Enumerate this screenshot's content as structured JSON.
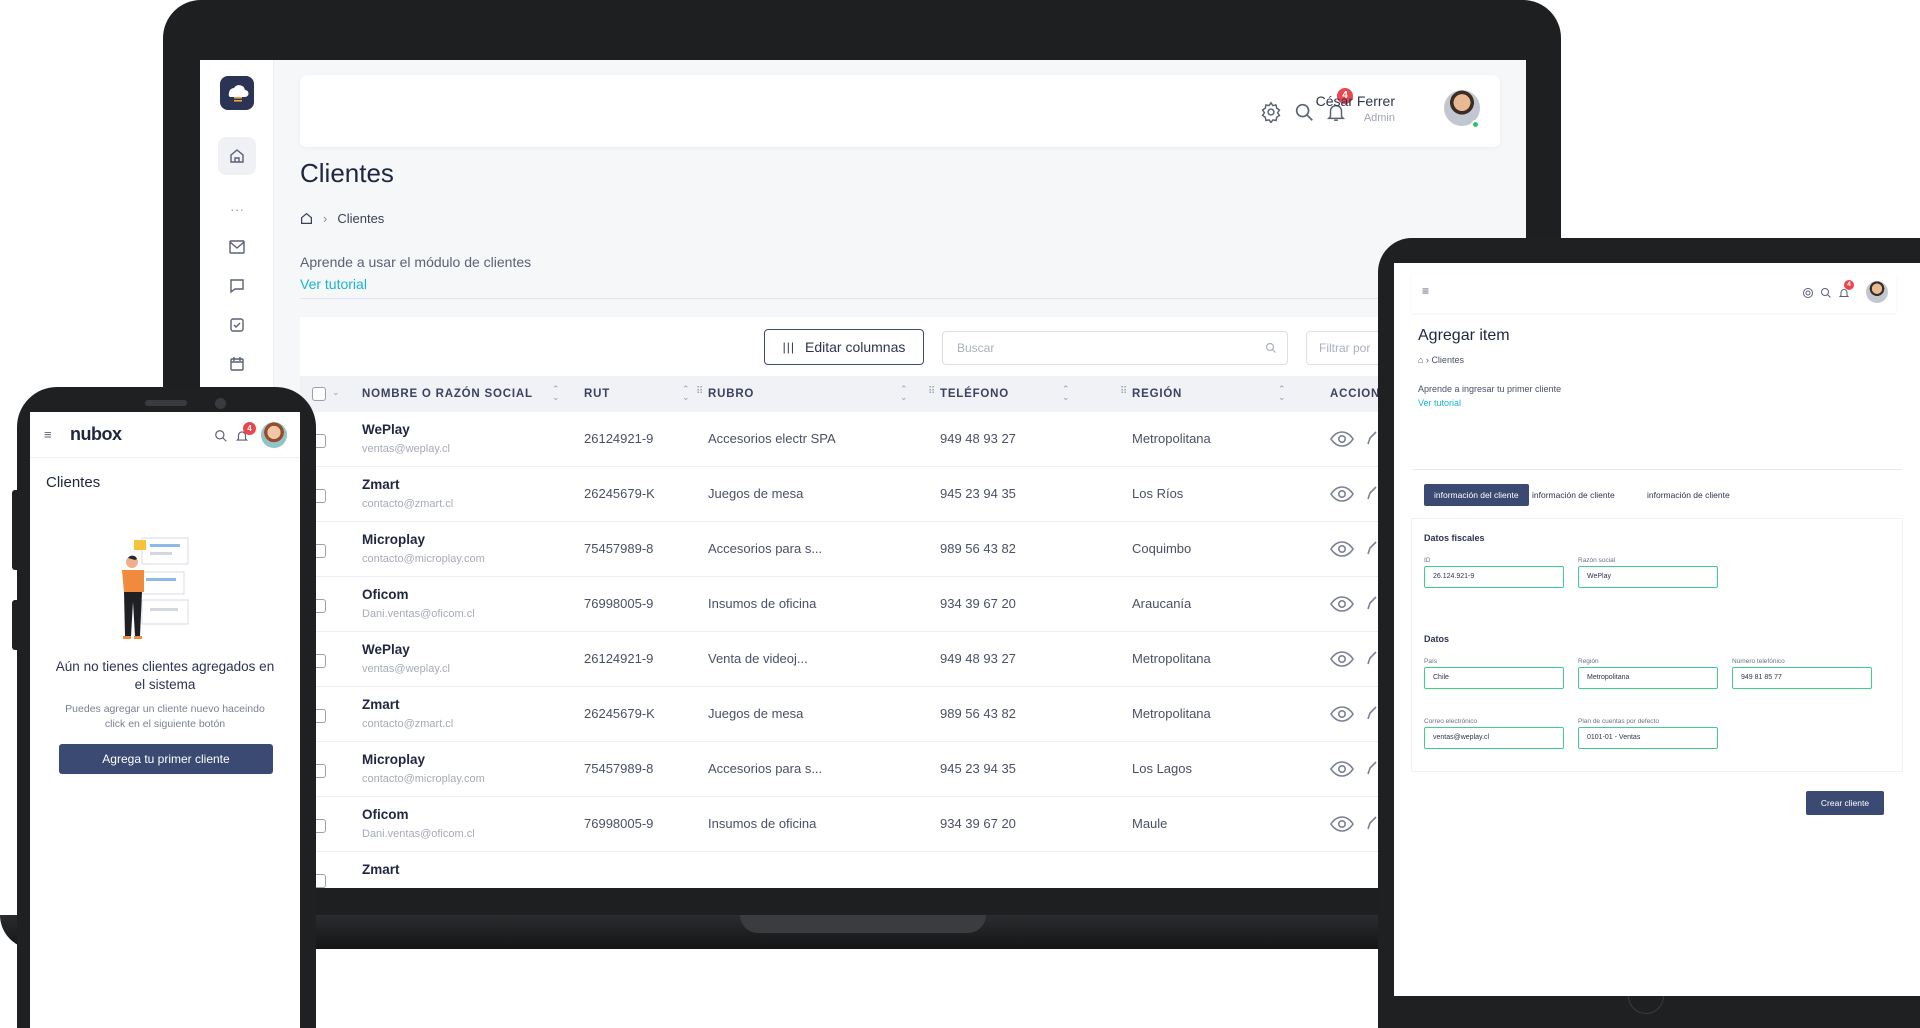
{
  "laptop": {
    "user": {
      "name": "César Ferrer",
      "role": "Admin",
      "notifications": "4"
    },
    "page_title": "Clientes",
    "breadcrumb": {
      "current": "Clientes"
    },
    "learn_text": "Aprende a usar el módulo de clientes",
    "tutorial_link": "Ver tutorial",
    "toolbar": {
      "edit_columns": "Editar columnas",
      "search_placeholder": "Buscar",
      "filter_placeholder": "Filtrar por"
    },
    "columns": [
      "NOMBRE O RAZÓN SOCIAL",
      "RUT",
      "RUBRO",
      "TELÉFONO",
      "REGIÓN",
      "ACCIONES"
    ],
    "rows": [
      {
        "name": "WePlay",
        "email": "ventas@weplay.cl",
        "rut": "26124921-9",
        "rubro": "Accesorios electr SPA",
        "phone": "949 48 93 27",
        "region": "Metropolitana"
      },
      {
        "name": "Zmart",
        "email": "contacto@zmart.cl",
        "rut": "26245679-K",
        "rubro": "Juegos de mesa",
        "phone": "945 23 94 35",
        "region": "Los Ríos"
      },
      {
        "name": "Microplay",
        "email": "contacto@microplay.com",
        "rut": "75457989-8",
        "rubro": "Accesorios para s...",
        "phone": "989 56 43 82",
        "region": "Coquimbo"
      },
      {
        "name": "Oficom",
        "email": "Dani.ventas@oficom.cl",
        "rut": "76998005-9",
        "rubro": "Insumos de oficina",
        "phone": "934 39 67 20",
        "region": "Araucanía"
      },
      {
        "name": "WePlay",
        "email": "ventas@weplay.cl",
        "rut": "26124921-9",
        "rubro": "Venta de videoj...",
        "phone": "949 48 93 27",
        "region": "Metropolitana"
      },
      {
        "name": "Zmart",
        "email": "contacto@zmart.cl",
        "rut": "26245679-K",
        "rubro": "Juegos de mesa",
        "phone": "989 56 43 82",
        "region": "Metropolitana"
      },
      {
        "name": "Microplay",
        "email": "contacto@microplay.com",
        "rut": "75457989-8",
        "rubro": "Accesorios para s...",
        "phone": "945 23 94 35",
        "region": "Los Lagos"
      },
      {
        "name": "Oficom",
        "email": "Dani.ventas@oficom.cl",
        "rut": "76998005-9",
        "rubro": "Insumos de oficina",
        "phone": "934 39 67 20",
        "region": "Maule"
      },
      {
        "name": "Zmart",
        "email": "",
        "rut": "",
        "rubro": "",
        "phone": "",
        "region": ""
      }
    ]
  },
  "phone": {
    "logo": "nubox",
    "notifications": "4",
    "title": "Clientes",
    "empty_heading": "Aún no tienes clientes agregados en el sistema",
    "empty_text": "Puedes agregar un cliente nuevo haceindo click en el siguiente botón",
    "cta": "Agrega tu primer cliente"
  },
  "tablet": {
    "notifications": "4",
    "title": "Agregar item",
    "breadcrumb": "Clientes",
    "learn_text": "Aprende a ingresar tu primer cliente",
    "tutorial_link": "Ver tutorial",
    "tabs": [
      "información del cliente",
      "información de cliente",
      "información de cliente"
    ],
    "section_fiscal": "Datos fiscales",
    "section_data": "Datos",
    "fields": {
      "id": {
        "label": "ID",
        "value": "26.124.921-9"
      },
      "razon": {
        "label": "Razón social",
        "value": "WePlay"
      },
      "pais": {
        "label": "País",
        "value": "Chile"
      },
      "region": {
        "label": "Región",
        "value": "Metropolitana"
      },
      "telefono": {
        "label": "Número telefónico",
        "value": "949 81 85 77"
      },
      "correo": {
        "label": "Correo electrónico",
        "value": "ventas@weplay.cl"
      },
      "plan": {
        "label": "Plan de cuentas por defecto",
        "value": "0101-01 - Ventas"
      }
    },
    "create_button": "Crear cliente"
  },
  "colors": {
    "primary": "#3b4a72",
    "link": "#18b5d1",
    "badge": "#e8484d",
    "input_border": "#3ecf8e"
  }
}
